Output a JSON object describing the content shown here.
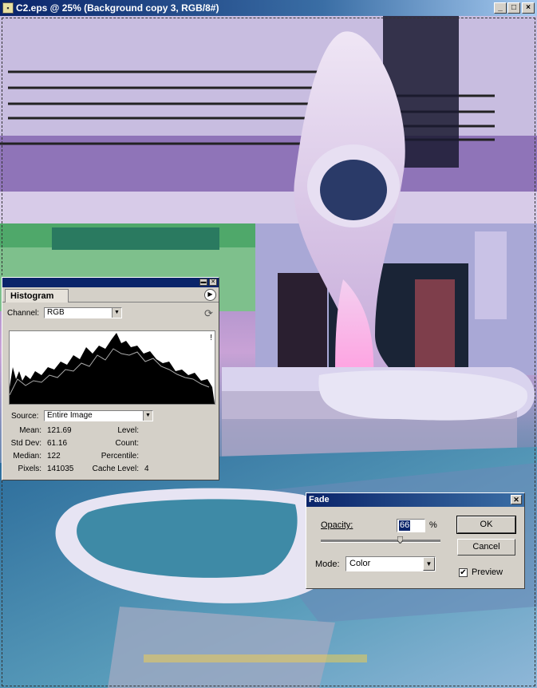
{
  "document": {
    "title": "C2.eps @ 25% (Background copy 3, RGB/8#)",
    "controls": {
      "minimize": "_",
      "maximize": "□",
      "close": "×"
    }
  },
  "histogram": {
    "tab_label": "Histogram",
    "channel_label": "Channel:",
    "channel_value": "RGB",
    "source_label": "Source:",
    "source_value": "Entire Image",
    "warning_icon": "!",
    "stats_left": [
      {
        "label": "Mean:",
        "value": "121.69"
      },
      {
        "label": "Std Dev:",
        "value": "61.16"
      },
      {
        "label": "Median:",
        "value": "122"
      },
      {
        "label": "Pixels:",
        "value": "141035"
      }
    ],
    "stats_right": [
      {
        "label": "Level:",
        "value": ""
      },
      {
        "label": "Count:",
        "value": ""
      },
      {
        "label": "Percentile:",
        "value": ""
      },
      {
        "label": "Cache Level:",
        "value": "4"
      }
    ]
  },
  "fade": {
    "title": "Fade",
    "opacity_label": "Opacity:",
    "opacity_value": "66",
    "percent_sign": "%",
    "opacity_fraction": 0.66,
    "mode_label": "Mode:",
    "mode_value": "Color",
    "ok_label": "OK",
    "cancel_label": "Cancel",
    "preview_label": "Preview",
    "preview_checked": true
  },
  "colors": {
    "titlebar_dark": "#0a246a",
    "titlebar_light": "#a6caf0",
    "dialog_face": "#d4d0c8"
  }
}
